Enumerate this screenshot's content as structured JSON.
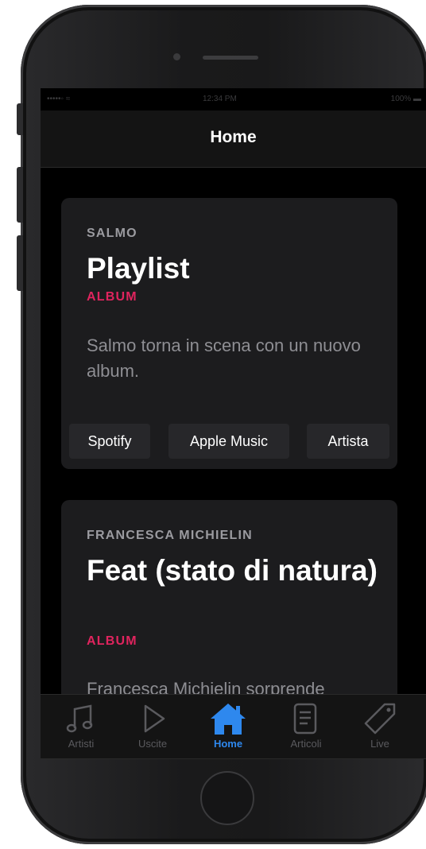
{
  "status_bar": {
    "carrier": "•••••◦ ≈",
    "time": "12:34 PM",
    "battery": "100% ▬"
  },
  "nav": {
    "title": "Home"
  },
  "cards": [
    {
      "artist": "SALMO",
      "title": "Playlist",
      "type": "ALBUM",
      "description": "Salmo torna in scena con un nuovo album.",
      "buttons": [
        "Spotify",
        "Apple Music",
        "Artista"
      ]
    },
    {
      "artist": "FRANCESCA MICHIELIN",
      "title": "Feat (stato di natura)",
      "type": "ALBUM",
      "description": "Francesca Michielin sorprende"
    }
  ],
  "tabs": [
    {
      "label": "Artisti",
      "icon": "music-note-icon",
      "active": false
    },
    {
      "label": "Uscite",
      "icon": "play-icon",
      "active": false
    },
    {
      "label": "Home",
      "icon": "home-icon",
      "active": true
    },
    {
      "label": "Articoli",
      "icon": "article-icon",
      "active": false
    },
    {
      "label": "Live",
      "icon": "tag-icon",
      "active": false
    }
  ],
  "colors": {
    "accent_blue": "#2e88ee",
    "album_red": "#e0245e",
    "card_bg": "#1c1c1e",
    "screen_bg": "#000000"
  }
}
